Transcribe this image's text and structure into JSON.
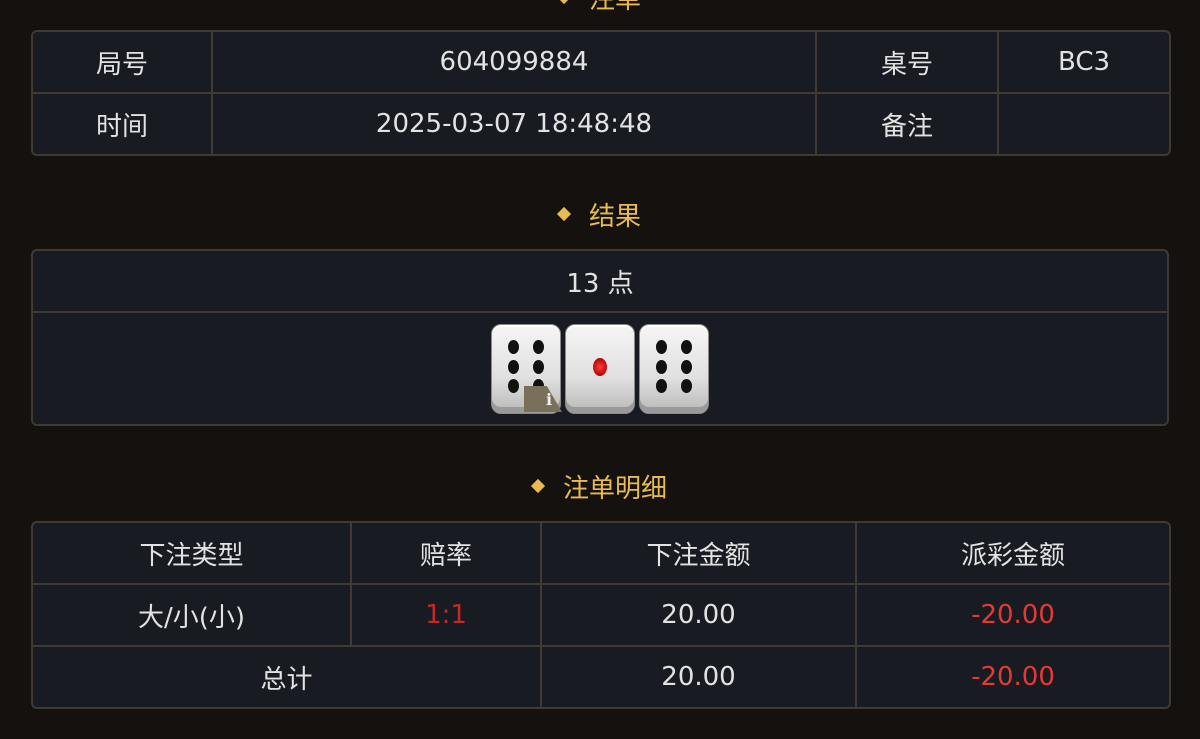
{
  "sections": {
    "bet_title": "注单",
    "result_title": "结果",
    "detail_title": "注单明细"
  },
  "bet_info": {
    "round_label": "局号",
    "round_value": "604099884",
    "table_label": "桌号",
    "table_value": "BC3",
    "time_label": "时间",
    "time_value": "2025-03-07 18:48:48",
    "note_label": "备注",
    "note_value": ""
  },
  "result": {
    "points_text": "13 点",
    "dice": [
      6,
      1,
      6
    ],
    "info_icon": "i"
  },
  "details": {
    "headers": [
      "下注类型",
      "赔率",
      "下注金额",
      "派彩金额"
    ],
    "rows": [
      {
        "type": "大/小(小)",
        "odds": "1:1",
        "bet": "20.00",
        "payout": "-20.00"
      }
    ],
    "total_label": "总计",
    "total_bet": "20.00",
    "total_payout": "-20.00"
  },
  "colors": {
    "accent": "#e8bb52",
    "negative": "#e53935",
    "background": "#14110e",
    "panel": "#181b22",
    "border": "#3f3a32"
  },
  "icons": {
    "section_marker": "diamond-icon",
    "info": "info-icon"
  }
}
